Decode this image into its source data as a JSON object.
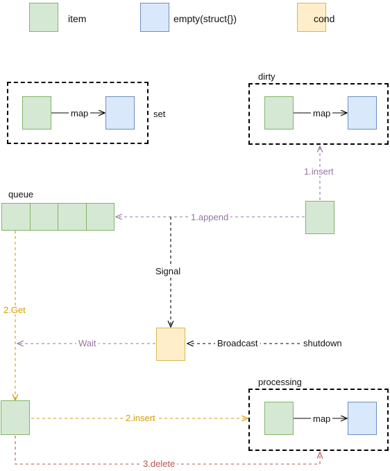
{
  "legend": {
    "items": [
      {
        "label": "item",
        "fill": "#d5e8d4",
        "stroke": "#82b366",
        "swatch_name": "item-swatch"
      },
      {
        "label": "empty(struct{})",
        "fill": "#dae8fc",
        "stroke": "#6c8ebf",
        "swatch_name": "empty-swatch"
      },
      {
        "label": "cond",
        "fill": "#ffe6cc",
        "stroke": "#d6b656",
        "swatch_name": "cond-swatch"
      }
    ]
  },
  "colors": {
    "item_fill": "#d5e8d4",
    "item_stroke": "#82b366",
    "empty_fill": "#dae8fc",
    "empty_stroke": "#6c8ebf",
    "cond_fill": "#ffeec9",
    "cond_stroke": "#d6b656",
    "purple": "#9673a6",
    "orange": "#d79b00",
    "red": "#b85450",
    "black": "#000000"
  },
  "groups": {
    "set": {
      "title": "set"
    },
    "dirty": {
      "title": "dirty"
    },
    "processing": {
      "title": "processing"
    }
  },
  "nodes": {
    "queue": {
      "title": "queue",
      "cells": 4
    },
    "set_map_label": "map",
    "dirty_map_label": "map",
    "processing_map_label": "map"
  },
  "edges": [
    {
      "name": "insert-edge",
      "label": "1.insert",
      "color": "purple"
    },
    {
      "name": "append-edge",
      "label": "1.append",
      "color": "purple"
    },
    {
      "name": "signal-edge",
      "label": "Signal",
      "color": "black"
    },
    {
      "name": "get-edge",
      "label": "2.Get",
      "color": "orange"
    },
    {
      "name": "wait-edge",
      "label": "Wait",
      "color": "purple"
    },
    {
      "name": "broadcast-edge",
      "label": "Broadcast",
      "color": "black"
    },
    {
      "name": "shutdown-edge",
      "label": "shutdown",
      "color": "black"
    },
    {
      "name": "insert2-edge",
      "label": "2.insert",
      "color": "orange"
    },
    {
      "name": "delete-edge",
      "label": "3.delete",
      "color": "red"
    }
  ]
}
